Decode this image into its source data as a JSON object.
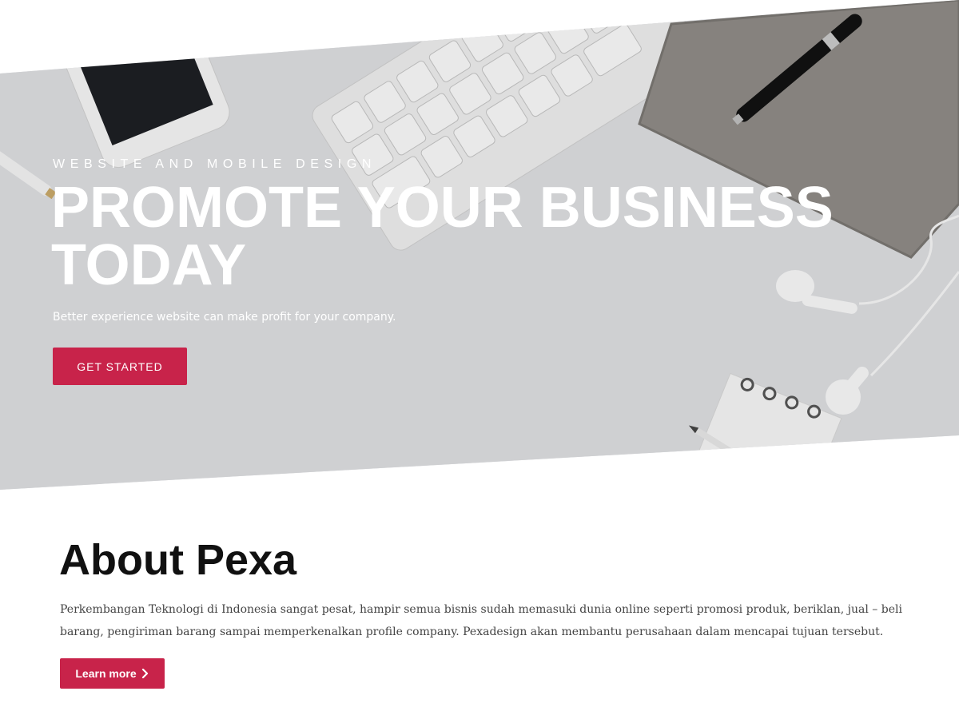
{
  "hero": {
    "eyebrow": "WEBSITE AND MOBILE DESIGN",
    "title": "PROMOTE YOUR BUSINESS TODAY",
    "subtitle": "Better experience website can make profit for your company.",
    "cta_label": "GET STARTED",
    "background_icons": [
      "smartphone-icon",
      "keyboard-icon",
      "notebook-icon",
      "pen-icon",
      "earphones-icon",
      "spiral-notepad-icon",
      "pencil-icon"
    ]
  },
  "about": {
    "title": "About Pexa",
    "body": "Perkembangan Teknologi di Indonesia sangat pesat, hampir semua bisnis sudah memasuki dunia online seperti promosi produk, beriklan, jual – beli barang, pengiriman barang sampai memperkenalkan profile company. Pexadesign akan membantu perusahaan dalam mencapai tujuan tersebut.",
    "button_label": "Learn more",
    "button_icon": "chevron-right-icon"
  },
  "colors": {
    "accent": "#c8234a",
    "hero_background": "#dcdde0",
    "heading": "#111111",
    "body_text": "#444444"
  }
}
